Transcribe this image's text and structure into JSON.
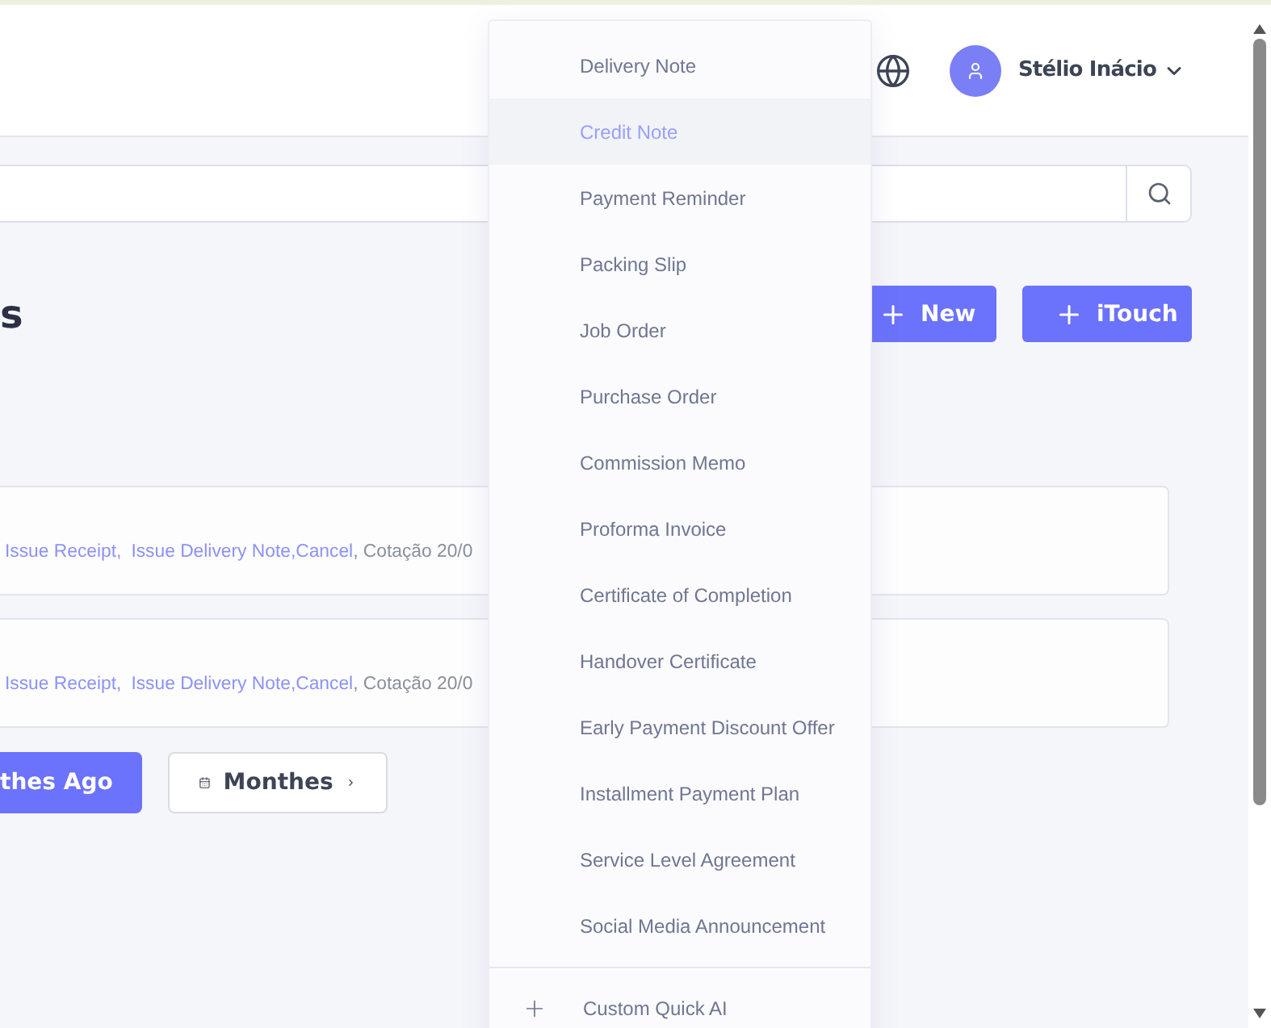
{
  "header": {
    "user_name": "Stélio Inácio"
  },
  "page_title": "s",
  "actions": [
    {
      "kind": "add",
      "label": "New"
    },
    {
      "kind": "add",
      "label": "iTouch"
    }
  ],
  "rows": [
    {
      "links": [
        "Issue Receipt,",
        "Issue Delivery Note,",
        "Cancel"
      ],
      "text": ", Cotação 20/0"
    },
    {
      "links": [
        "Issue Receipt,",
        "Issue Delivery Note,",
        "Cancel"
      ],
      "text": ", Cotação 20/0"
    }
  ],
  "period_buttons": [
    {
      "kind": "plain",
      "label": "thes Ago",
      "selected": true
    },
    {
      "kind": "calendar",
      "label": "Monthes",
      "selected": false
    }
  ],
  "menu": {
    "items": [
      {
        "label": "Delivery Note",
        "selected": false
      },
      {
        "label": "Credit Note",
        "selected": true
      },
      {
        "label": "Payment Reminder",
        "selected": false
      },
      {
        "label": "Packing Slip",
        "selected": false
      },
      {
        "label": "Job Order",
        "selected": false
      },
      {
        "label": "Purchase Order",
        "selected": false
      },
      {
        "label": "Commission Memo",
        "selected": false
      },
      {
        "label": "Proforma Invoice",
        "selected": false
      },
      {
        "label": "Certificate of Completion",
        "selected": false
      },
      {
        "label": "Handover Certificate",
        "selected": false
      },
      {
        "label": "Early Payment Discount Offer",
        "selected": false
      },
      {
        "label": "Installment Payment Plan",
        "selected": false
      },
      {
        "label": "Service Level Agreement",
        "selected": false
      },
      {
        "label": "Social Media Announcement",
        "selected": false
      }
    ],
    "footer": "Custom Quick AI"
  }
}
